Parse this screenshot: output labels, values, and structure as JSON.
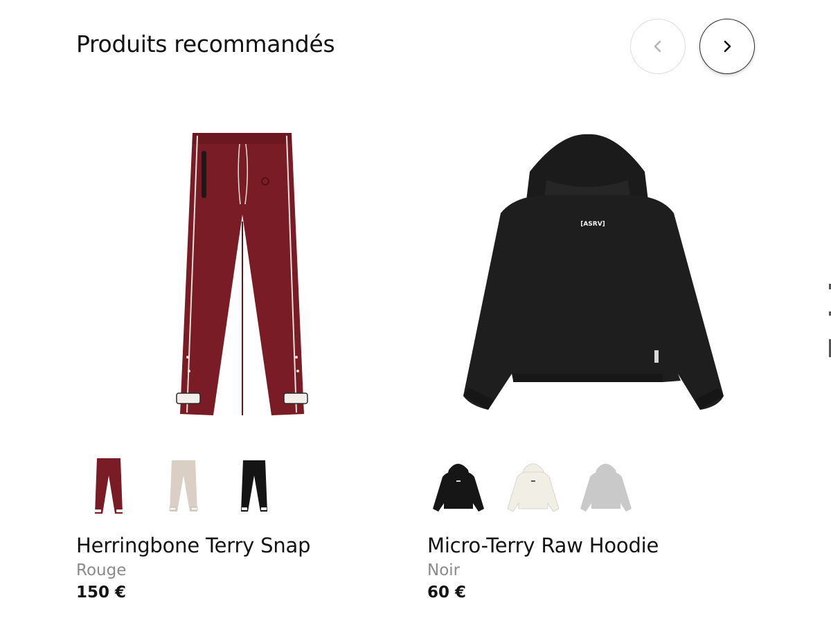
{
  "section": {
    "title": "Produits recommandés"
  },
  "carousel": {
    "prev_icon": "chevron-left-icon",
    "next_icon": "chevron-right-icon"
  },
  "products": [
    {
      "name": "Herringbone Terry Snap",
      "color": "Rouge",
      "price": "150 €",
      "image": "track-pants-image",
      "swatches": [
        {
          "color_hex": "#7a1c25"
        },
        {
          "color_hex": "#d9cfc4"
        },
        {
          "color_hex": "#141414"
        }
      ]
    },
    {
      "name": "Micro-Terry Raw Hoodie",
      "color": "Noir",
      "price": "60 €",
      "image": "hoodie-image",
      "logo_text": "[ASRV]",
      "swatches": [
        {
          "color_hex": "#161616"
        },
        {
          "color_hex": "#f1eee6"
        },
        {
          "color_hex": "#c9c9c9"
        }
      ]
    }
  ]
}
